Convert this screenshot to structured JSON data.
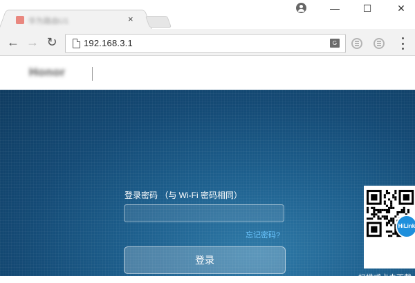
{
  "browser": {
    "tab": {
      "title": "华为路由U1",
      "close_glyph": "×"
    },
    "window_controls": {
      "minimize": "—",
      "maximize": "☐",
      "close": "✕"
    },
    "nav": {
      "back": "←",
      "forward": "→",
      "reload": "↻"
    },
    "address_bar": {
      "url": "192.168.3.1"
    },
    "translate_glyph": "G"
  },
  "page": {
    "header": {
      "brand": "Honor"
    },
    "login": {
      "password_label": "登录密码 （与 Wi-Fi 密码相同）",
      "password_value": "",
      "forgot_link": "忘记密码?",
      "submit_label": "登录"
    },
    "qr": {
      "badge": "HiLink",
      "caption": "扫描或点击下载"
    }
  }
}
